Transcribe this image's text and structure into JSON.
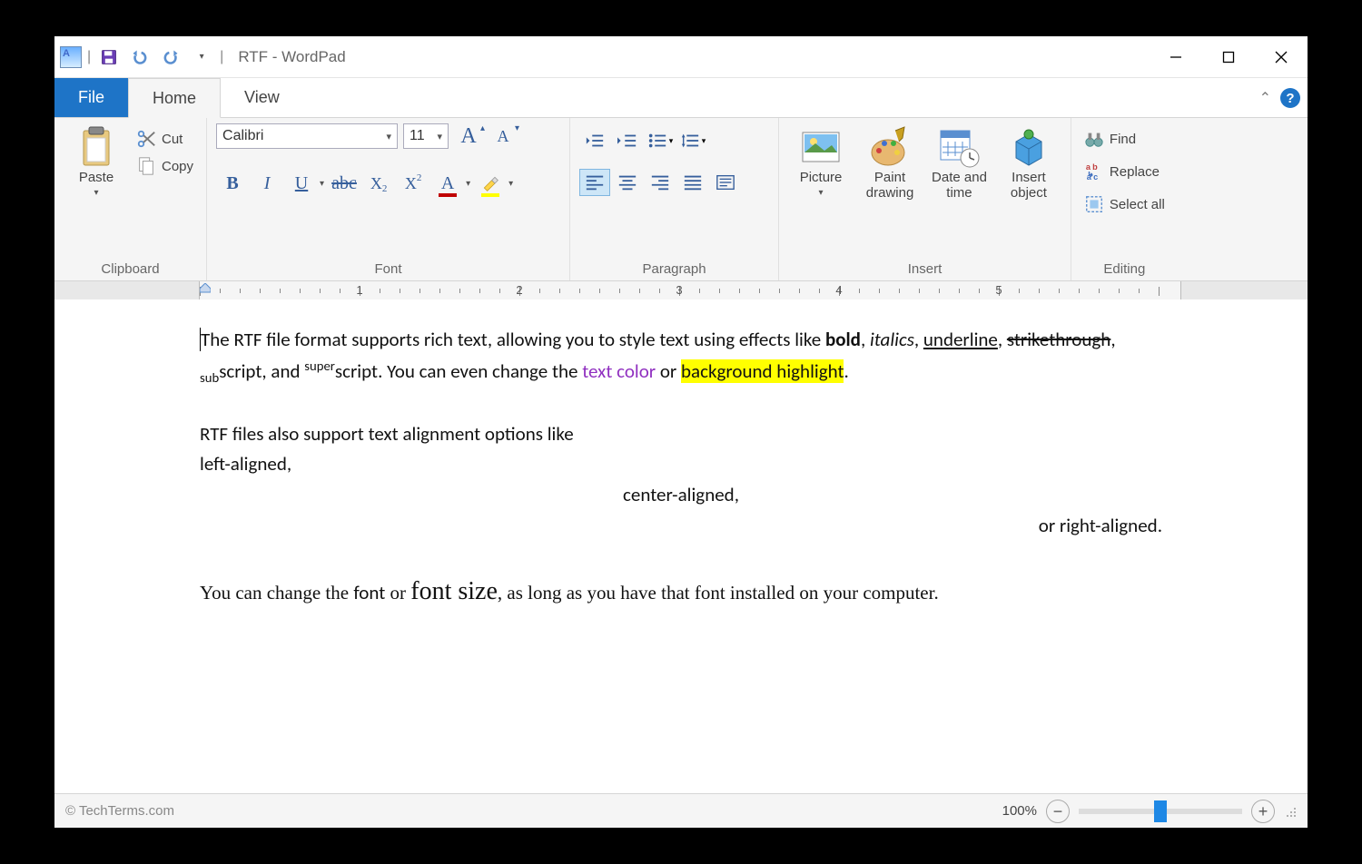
{
  "title": "RTF - WordPad",
  "qat": {
    "save": "save",
    "undo": "undo",
    "redo": "redo"
  },
  "tabs": {
    "file": "File",
    "home": "Home",
    "view": "View"
  },
  "ribbon": {
    "clipboard": {
      "label": "Clipboard",
      "paste": "Paste",
      "cut": "Cut",
      "copy": "Copy"
    },
    "font": {
      "label": "Font",
      "name": "Calibri",
      "size": "11",
      "grow": "A",
      "shrink": "A",
      "bold": "B",
      "italic": "I",
      "underline": "U",
      "strike": "abc",
      "subscript": "X",
      "superscript": "X",
      "color": "A"
    },
    "paragraph": {
      "label": "Paragraph"
    },
    "insert": {
      "label": "Insert",
      "picture": "Picture",
      "paint": "Paint\ndrawing",
      "datetime": "Date and\ntime",
      "object": "Insert\nobject"
    },
    "editing": {
      "label": "Editing",
      "find": "Find",
      "replace": "Replace",
      "selectall": "Select all"
    }
  },
  "ruler_numbers": [
    "1",
    "2",
    "3",
    "4",
    "5"
  ],
  "doc": {
    "p1_a": "The RTF file format supports rich text, allowing you to style text using effects like ",
    "bold": "bold",
    "p1_b": ", ",
    "italics": "italics",
    "p1_c": ", ",
    "underline": "underline",
    "p1_d": ", ",
    "strike": "strikethrough",
    "p1_e": ", ",
    "sub": "sub",
    "p1_f": "script, and ",
    "sup": "super",
    "p1_g": "script. You can even change the ",
    "tcolor": "text color",
    "p1_h": " or ",
    "highlight": "background highlight",
    "p1_i": ".",
    "p2": "RTF files also support text alignment options like",
    "p3": "left-aligned,",
    "p4": "center-aligned,",
    "p5": "or right-aligned.",
    "p6_a": "You can change the ",
    "p6_font": "font",
    "p6_b": " or ",
    "p6_size": "font size",
    "p6_c": ", as long as you have that font installed on your computer."
  },
  "status": {
    "left": "© TechTerms.com",
    "zoom": "100%"
  },
  "colors": {
    "accent": "#1e74c7",
    "highlight": "#ffff00",
    "textcolor": "#9030c0",
    "font_color_bar": "#c00000",
    "hl_color_bar": "#ffff00"
  }
}
